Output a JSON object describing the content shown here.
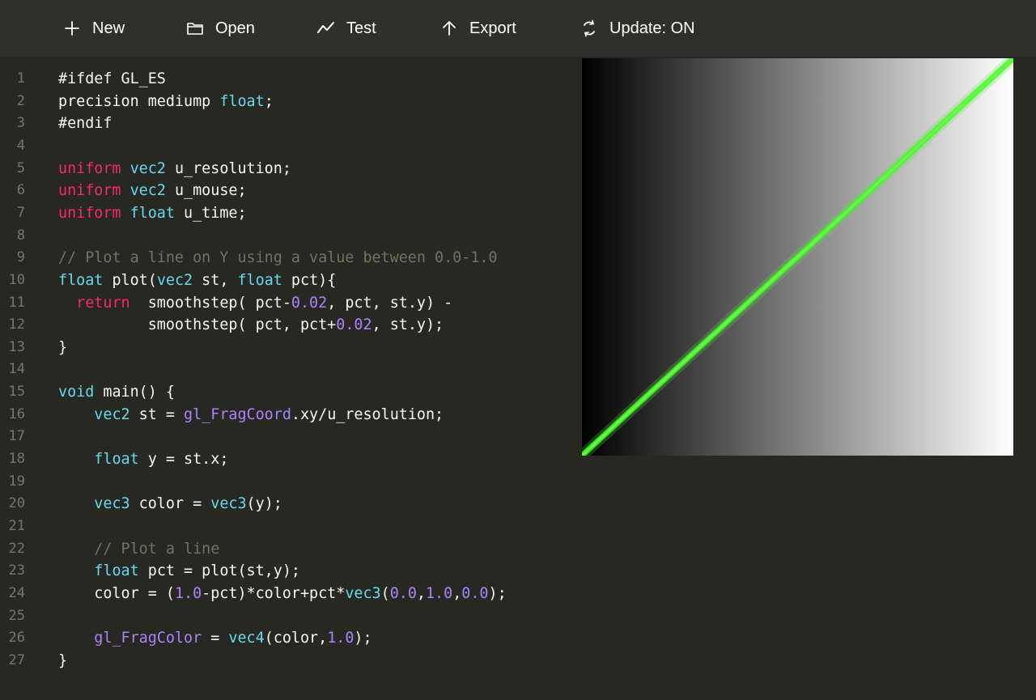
{
  "toolbar": {
    "buttons": [
      {
        "id": "new",
        "label": "New",
        "icon": "plus-icon"
      },
      {
        "id": "open",
        "label": "Open",
        "icon": "folder-icon"
      },
      {
        "id": "test",
        "label": "Test",
        "icon": "line-chart-icon"
      },
      {
        "id": "export",
        "label": "Export",
        "icon": "arrow-up-icon"
      },
      {
        "id": "update",
        "label": "Update: ON",
        "icon": "refresh-icon"
      }
    ]
  },
  "editor": {
    "lines": [
      {
        "n": "1",
        "tokens": [
          [
            "plain",
            "#ifdef GL_ES"
          ]
        ]
      },
      {
        "n": "2",
        "tokens": [
          [
            "plain",
            "precision mediump "
          ],
          [
            "type",
            "float"
          ],
          [
            "plain",
            ";"
          ]
        ]
      },
      {
        "n": "3",
        "tokens": [
          [
            "plain",
            "#endif"
          ]
        ]
      },
      {
        "n": "4",
        "tokens": []
      },
      {
        "n": "5",
        "tokens": [
          [
            "kw",
            "uniform"
          ],
          [
            "plain",
            " "
          ],
          [
            "type",
            "vec2"
          ],
          [
            "plain",
            " u_resolution;"
          ]
        ]
      },
      {
        "n": "6",
        "tokens": [
          [
            "kw",
            "uniform"
          ],
          [
            "plain",
            " "
          ],
          [
            "type",
            "vec2"
          ],
          [
            "plain",
            " u_mouse;"
          ]
        ]
      },
      {
        "n": "7",
        "tokens": [
          [
            "kw",
            "uniform"
          ],
          [
            "plain",
            " "
          ],
          [
            "type",
            "float"
          ],
          [
            "plain",
            " u_time;"
          ]
        ]
      },
      {
        "n": "8",
        "tokens": []
      },
      {
        "n": "9",
        "tokens": [
          [
            "comment",
            "// Plot a line on Y using a value between 0.0-1.0"
          ]
        ]
      },
      {
        "n": "10",
        "tokens": [
          [
            "type",
            "float"
          ],
          [
            "plain",
            " plot("
          ],
          [
            "type",
            "vec2"
          ],
          [
            "plain",
            " st, "
          ],
          [
            "type",
            "float"
          ],
          [
            "plain",
            " pct){"
          ]
        ]
      },
      {
        "n": "11",
        "tokens": [
          [
            "plain",
            "  "
          ],
          [
            "kw",
            "return"
          ],
          [
            "plain",
            "  smoothstep( pct-"
          ],
          [
            "num",
            "0.02"
          ],
          [
            "plain",
            ", pct, st.y) -"
          ]
        ]
      },
      {
        "n": "12",
        "tokens": [
          [
            "plain",
            "          smoothstep( pct, pct+"
          ],
          [
            "num",
            "0.02"
          ],
          [
            "plain",
            ", st.y);"
          ]
        ]
      },
      {
        "n": "13",
        "tokens": [
          [
            "plain",
            "}"
          ]
        ]
      },
      {
        "n": "14",
        "tokens": []
      },
      {
        "n": "15",
        "tokens": [
          [
            "type",
            "void"
          ],
          [
            "plain",
            " main() {"
          ]
        ]
      },
      {
        "n": "16",
        "tokens": [
          [
            "plain",
            "    "
          ],
          [
            "type",
            "vec2"
          ],
          [
            "plain",
            " st = "
          ],
          [
            "builtin",
            "gl_FragCoord"
          ],
          [
            "plain",
            ".xy/u_resolution;"
          ]
        ]
      },
      {
        "n": "17",
        "tokens": []
      },
      {
        "n": "18",
        "tokens": [
          [
            "plain",
            "    "
          ],
          [
            "type",
            "float"
          ],
          [
            "plain",
            " y = st.x;"
          ]
        ]
      },
      {
        "n": "19",
        "tokens": []
      },
      {
        "n": "20",
        "tokens": [
          [
            "plain",
            "    "
          ],
          [
            "type",
            "vec3"
          ],
          [
            "plain",
            " color = "
          ],
          [
            "type",
            "vec3"
          ],
          [
            "plain",
            "(y);"
          ]
        ]
      },
      {
        "n": "21",
        "tokens": []
      },
      {
        "n": "22",
        "tokens": [
          [
            "plain",
            "    "
          ],
          [
            "comment",
            "// Plot a line"
          ]
        ]
      },
      {
        "n": "23",
        "tokens": [
          [
            "plain",
            "    "
          ],
          [
            "type",
            "float"
          ],
          [
            "plain",
            " pct = plot(st,y);"
          ]
        ]
      },
      {
        "n": "24",
        "tokens": [
          [
            "plain",
            "    color = ("
          ],
          [
            "num",
            "1.0"
          ],
          [
            "plain",
            "-pct)*color+pct*"
          ],
          [
            "type",
            "vec3"
          ],
          [
            "plain",
            "("
          ],
          [
            "num",
            "0.0"
          ],
          [
            "plain",
            ","
          ],
          [
            "num",
            "1.0"
          ],
          [
            "plain",
            ","
          ],
          [
            "num",
            "0.0"
          ],
          [
            "plain",
            ");"
          ]
        ]
      },
      {
        "n": "25",
        "tokens": []
      },
      {
        "n": "26",
        "tokens": [
          [
            "plain",
            "    "
          ],
          [
            "builtin",
            "gl_FragColor"
          ],
          [
            "plain",
            " = "
          ],
          [
            "type",
            "vec4"
          ],
          [
            "plain",
            "(color,"
          ],
          [
            "num",
            "1.0"
          ],
          [
            "plain",
            ");"
          ]
        ]
      },
      {
        "n": "27",
        "tokens": [
          [
            "plain",
            "}"
          ]
        ]
      }
    ]
  },
  "preview": {
    "gradient_from": "#000000",
    "gradient_to": "#ffffff",
    "line_color": "#4cf032"
  },
  "colors": {
    "background": "#272822",
    "toolbar": "#2f302b",
    "keyword": "#f92672",
    "type": "#66d9ef",
    "number": "#ae81ff",
    "comment": "#75715e",
    "text": "#f8f8f2",
    "line_number": "#75766f"
  }
}
